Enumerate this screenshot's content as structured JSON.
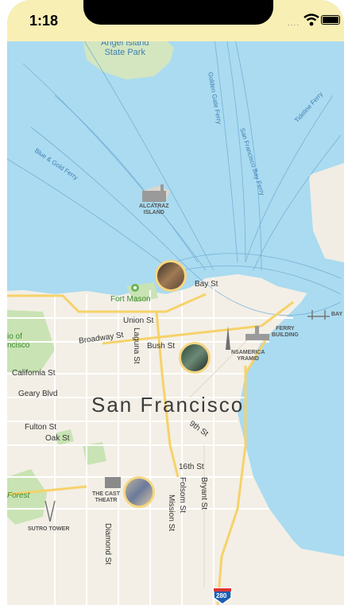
{
  "status_bar": {
    "time": "1:18",
    "signal": "....",
    "wifi": "wifi-icon",
    "battery": "battery-icon"
  },
  "map": {
    "city_label": "San Francisco",
    "landmarks": {
      "angel_island": "Angel Island\nState Park",
      "alcatraz": "ALCATRAZ\nISLAND",
      "fort_mason": "Fort Mason",
      "ferry_building": "FERRY\nBUILDING",
      "transamerica": "NSAMERICA\nYRAMID",
      "castro_theatre": "THE CAST\nTHEATR",
      "sutro_tower": "SUTRO TOWER",
      "presidio": "io of\nncisco",
      "forest": "Forest",
      "bay_bridge": "BAY"
    },
    "ferry_routes": [
      "Golden Gate Ferry",
      "San Francisco Bay Ferry",
      "Tideline Ferry",
      "Blue & Gold Ferry"
    ],
    "streets": [
      "Union St",
      "Broadway St",
      "Bush St",
      "California St",
      "Geary Blvd",
      "Fulton St",
      "Oak St",
      "9th St",
      "16th St",
      "Folsom St",
      "Bryant St",
      "Mission St",
      "Diamond St",
      "Laguna St",
      "Bay St"
    ],
    "highway_shield": "280"
  },
  "photo_pins": [
    {
      "name": "fishermans-wharf"
    },
    {
      "name": "chinatown"
    },
    {
      "name": "castro"
    }
  ]
}
